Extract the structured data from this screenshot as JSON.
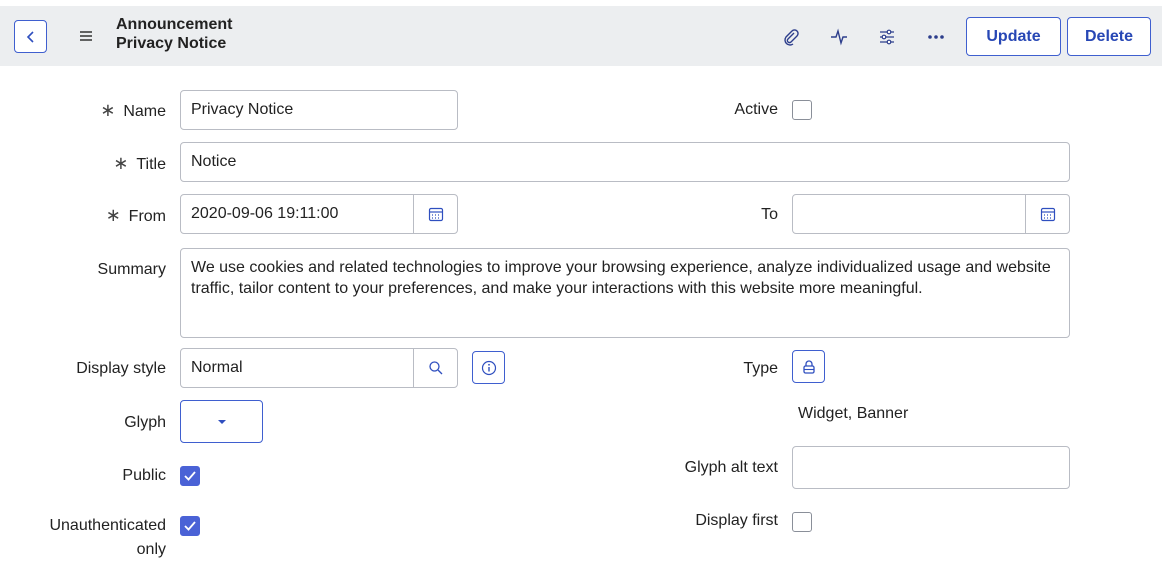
{
  "header": {
    "table_name": "Announcement",
    "record_name": "Privacy Notice",
    "icons": [
      "back-icon",
      "menu-icon",
      "attachment-icon",
      "activity-icon",
      "settings-sliders-icon",
      "more-icon"
    ],
    "update_label": "Update",
    "delete_label": "Delete"
  },
  "form": {
    "required_mark": "∗",
    "name": {
      "label": "Name",
      "value": "Privacy Notice"
    },
    "active": {
      "label": "Active",
      "checked": false
    },
    "title": {
      "label": "Title",
      "value": "Notice"
    },
    "from": {
      "label": "From",
      "value": "2020-09-06 19:11:00"
    },
    "to": {
      "label": "To",
      "value": ""
    },
    "summary": {
      "label": "Summary",
      "value": "We use cookies and related technologies to improve your browsing experience, analyze individualized usage and website traffic, tailor content to your preferences, and make your interactions with this website more meaningful."
    },
    "display_style": {
      "label": "Display style",
      "value": "Normal"
    },
    "type": {
      "label": "Type",
      "value": "Widget, Banner"
    },
    "glyph": {
      "label": "Glyph"
    },
    "public": {
      "label": "Public",
      "checked": true
    },
    "glyph_alt_text": {
      "label": "Glyph alt text",
      "value": ""
    },
    "unauthenticated_only": {
      "label_line1": "Unauthenticated",
      "label_line2": "only",
      "checked": true
    },
    "display_first": {
      "label": "Display first",
      "checked": false
    }
  },
  "colors": {
    "accent": "#3f5fcf",
    "checkbox_checked": "#4a62d6",
    "header_bg": "#eceef0"
  }
}
